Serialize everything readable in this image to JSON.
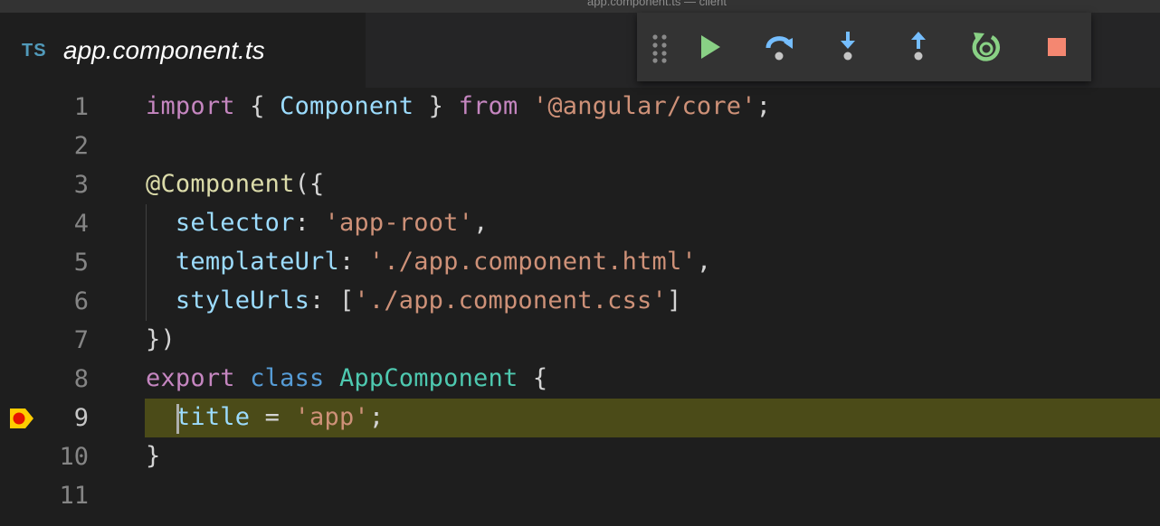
{
  "window": {
    "title": "app.component.ts — client"
  },
  "tab": {
    "lang_badge": "TS",
    "filename": "app.component.ts"
  },
  "debug_toolbar": {
    "continue_color": "#89d185",
    "step_color": "#75beff",
    "restart_color": "#89d185",
    "stop_color": "#f48771",
    "buttons": [
      "continue",
      "step-over",
      "step-into",
      "step-out",
      "restart",
      "stop"
    ]
  },
  "editor": {
    "current_line": 9,
    "breakpoint_line": 9,
    "highlight_color": "#4b4b18",
    "lines": [
      {
        "num": "1",
        "tokens": [
          [
            "kw",
            "import"
          ],
          [
            "pun",
            " { "
          ],
          [
            "var",
            "Component"
          ],
          [
            "pun",
            " } "
          ],
          [
            "kw",
            "from"
          ],
          [
            "pun",
            " "
          ],
          [
            "str",
            "'@angular/core'"
          ],
          [
            "pun",
            ";"
          ]
        ]
      },
      {
        "num": "2",
        "tokens": []
      },
      {
        "num": "3",
        "tokens": [
          [
            "dec",
            "@Component"
          ],
          [
            "pun",
            "({"
          ]
        ]
      },
      {
        "num": "4",
        "tokens": [
          [
            "pun",
            "  "
          ],
          [
            "var",
            "selector"
          ],
          [
            "pun",
            ": "
          ],
          [
            "str",
            "'app-root'"
          ],
          [
            "pun",
            ","
          ]
        ]
      },
      {
        "num": "5",
        "tokens": [
          [
            "pun",
            "  "
          ],
          [
            "var",
            "templateUrl"
          ],
          [
            "pun",
            ": "
          ],
          [
            "str",
            "'./app.component.html'"
          ],
          [
            "pun",
            ","
          ]
        ]
      },
      {
        "num": "6",
        "tokens": [
          [
            "pun",
            "  "
          ],
          [
            "var",
            "styleUrls"
          ],
          [
            "pun",
            ": ["
          ],
          [
            "str",
            "'./app.component.css'"
          ],
          [
            "pun",
            "]"
          ]
        ]
      },
      {
        "num": "7",
        "tokens": [
          [
            "pun",
            "})"
          ]
        ]
      },
      {
        "num": "8",
        "tokens": [
          [
            "kw",
            "export"
          ],
          [
            "pun",
            " "
          ],
          [
            "kw2",
            "class"
          ],
          [
            "pun",
            " "
          ],
          [
            "cls",
            "AppComponent"
          ],
          [
            "pun",
            " {"
          ]
        ]
      },
      {
        "num": "9",
        "tokens": [
          [
            "pun",
            "  "
          ],
          [
            "var",
            "title"
          ],
          [
            "pun",
            " = "
          ],
          [
            "str",
            "'app'"
          ],
          [
            "pun",
            ";"
          ]
        ]
      },
      {
        "num": "10",
        "tokens": [
          [
            "pun",
            "}"
          ]
        ]
      },
      {
        "num": "11",
        "tokens": []
      }
    ]
  }
}
